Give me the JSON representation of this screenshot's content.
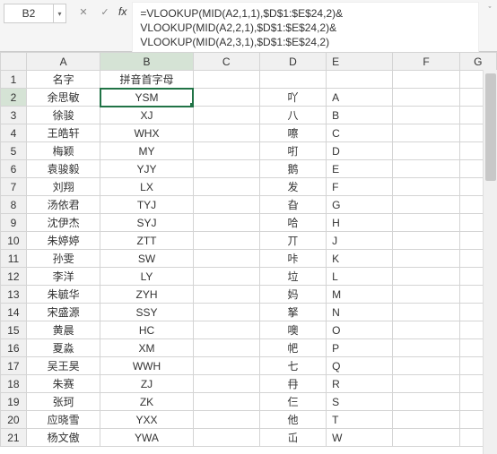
{
  "name_box": "B2",
  "formula_bar": "=VLOOKUP(MID(A2,1,1),$D$1:$E$24,2)&\nVLOOKUP(MID(A2,2,1),$D$1:$E$24,2)&\nVLOOKUP(MID(A2,3,1),$D$1:$E$24,2)",
  "columns": [
    "A",
    "B",
    "C",
    "D",
    "E",
    "F",
    "G"
  ],
  "selected": {
    "col": "B",
    "row": 2
  },
  "rows": [
    {
      "n": 1,
      "A": "名字",
      "B": "拼音首字母",
      "C": "",
      "D": "",
      "E": ""
    },
    {
      "n": 2,
      "A": "余思敏",
      "B": "YSM",
      "C": "",
      "D": "吖",
      "E": "A"
    },
    {
      "n": 3,
      "A": "徐骏",
      "B": "XJ",
      "C": "",
      "D": "八",
      "E": "B"
    },
    {
      "n": 4,
      "A": "王皓轩",
      "B": "WHX",
      "C": "",
      "D": "嚓",
      "E": "C"
    },
    {
      "n": 5,
      "A": "梅颖",
      "B": "MY",
      "C": "",
      "D": "咑",
      "E": "D"
    },
    {
      "n": 6,
      "A": "袁骏毅",
      "B": "YJY",
      "C": "",
      "D": "鹅",
      "E": "E"
    },
    {
      "n": 7,
      "A": "刘翔",
      "B": "LX",
      "C": "",
      "D": "发",
      "E": "F"
    },
    {
      "n": 8,
      "A": "汤依君",
      "B": "TYJ",
      "C": "",
      "D": "旮",
      "E": "G"
    },
    {
      "n": 9,
      "A": "沈伊杰",
      "B": "SYJ",
      "C": "",
      "D": "哈",
      "E": "H"
    },
    {
      "n": 10,
      "A": "朱婷婷",
      "B": "ZTT",
      "C": "",
      "D": "丌",
      "E": "J"
    },
    {
      "n": 11,
      "A": "孙雯",
      "B": "SW",
      "C": "",
      "D": "咔",
      "E": "K"
    },
    {
      "n": 12,
      "A": "李洋",
      "B": "LY",
      "C": "",
      "D": "垃",
      "E": "L"
    },
    {
      "n": 13,
      "A": "朱毓华",
      "B": "ZYH",
      "C": "",
      "D": "妈",
      "E": "M"
    },
    {
      "n": 14,
      "A": "宋盛源",
      "B": "SSY",
      "C": "",
      "D": "拏",
      "E": "N"
    },
    {
      "n": 15,
      "A": "黄晨",
      "B": "HC",
      "C": "",
      "D": "噢",
      "E": "O"
    },
    {
      "n": 16,
      "A": "夏淼",
      "B": "XM",
      "C": "",
      "D": "帊",
      "E": "P"
    },
    {
      "n": 17,
      "A": "吴王昊",
      "B": "WWH",
      "C": "",
      "D": "七",
      "E": "Q"
    },
    {
      "n": 18,
      "A": "朱赛",
      "B": "ZJ",
      "C": "",
      "D": "冄",
      "E": "R"
    },
    {
      "n": 19,
      "A": "张珂",
      "B": "ZK",
      "C": "",
      "D": "仨",
      "E": "S"
    },
    {
      "n": 20,
      "A": "应晓雪",
      "B": "YXX",
      "C": "",
      "D": "他",
      "E": "T"
    },
    {
      "n": 21,
      "A": "杨文傲",
      "B": "YWA",
      "C": "",
      "D": "屲",
      "E": "W"
    }
  ]
}
